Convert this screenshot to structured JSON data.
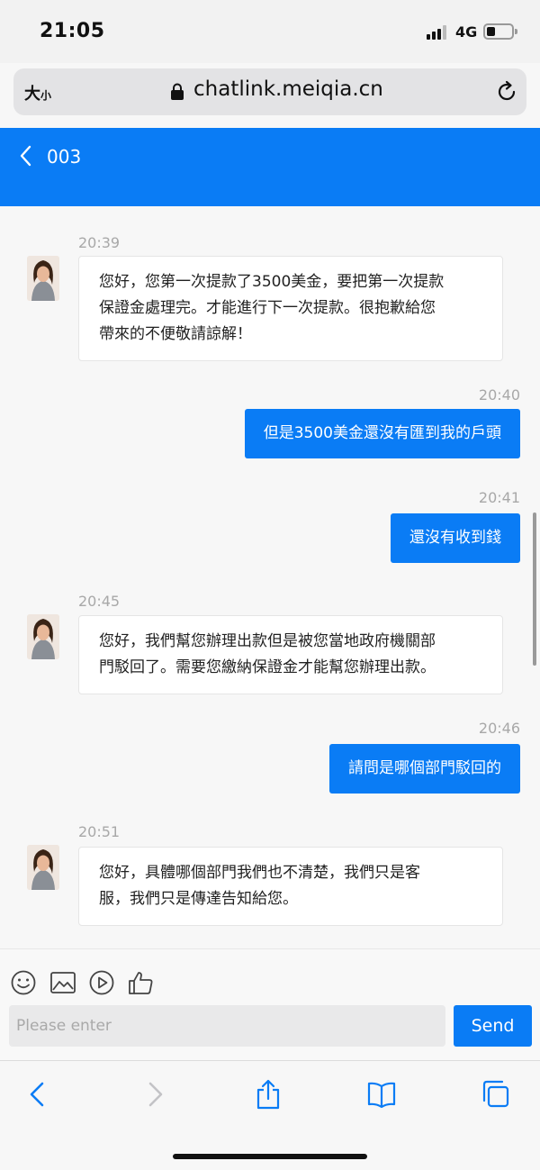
{
  "status_bar": {
    "time": "21:05",
    "network": "4G"
  },
  "browser": {
    "text_size_big": "大",
    "text_size_small": "小",
    "url": "chatlink.meiqia.cn"
  },
  "header": {
    "title": "003",
    "background_color": "#0a7cf5"
  },
  "messages": [
    {
      "direction": "in",
      "time": "20:39",
      "lines": [
        "您好，您第一次提款了3500美金，要把第一次提款",
        "保證金處理完。才能進行下一次提款。很抱歉給您",
        "帶來的不便敬請諒解！"
      ]
    },
    {
      "direction": "out",
      "time": "20:40",
      "text": "但是3500美金還沒有匯到我的戶頭"
    },
    {
      "direction": "out",
      "time": "20:41",
      "text": "還沒有收到錢"
    },
    {
      "direction": "in",
      "time": "20:45",
      "lines": [
        "您好，我們幫您辦理出款但是被您當地政府機關部",
        "門駁回了。需要您繳納保證金才能幫您辦理出款。"
      ]
    },
    {
      "direction": "out",
      "time": "20:46",
      "text": "請問是哪個部門駁回的"
    },
    {
      "direction": "in",
      "time": "20:51",
      "lines": [
        "您好，具體哪個部門我們也不清楚，我們只是客",
        "服，我們只是傳達告知給您。"
      ]
    }
  ],
  "composer": {
    "placeholder": "Please enter",
    "send_label": "Send",
    "tools": [
      "emoji-icon",
      "image-icon",
      "video-icon",
      "thumbs-up-icon"
    ]
  },
  "toolbar": {
    "icons": [
      "back-icon",
      "forward-icon",
      "share-icon",
      "bookmarks-icon",
      "tabs-icon"
    ]
  }
}
